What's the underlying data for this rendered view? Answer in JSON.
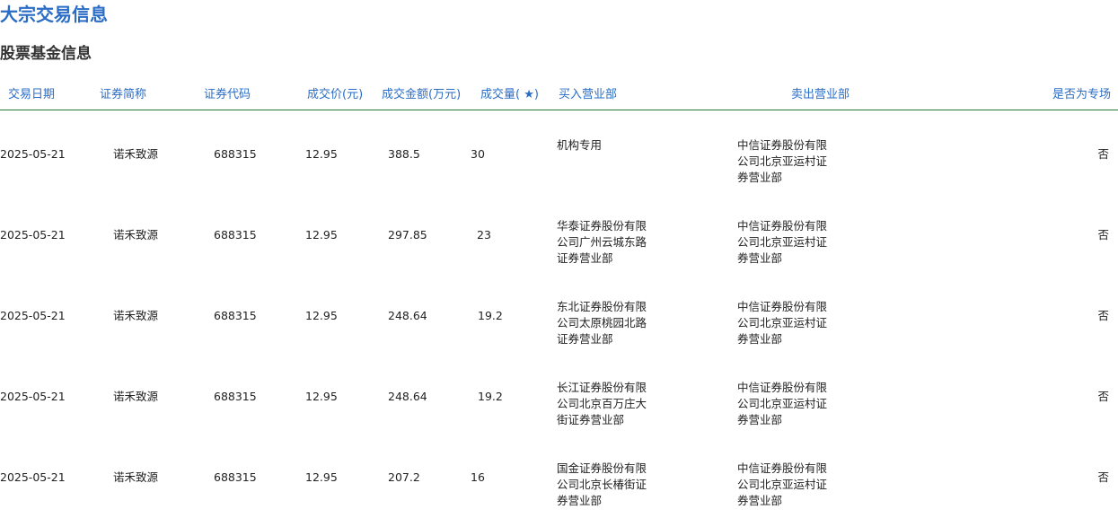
{
  "page": {
    "title": "大宗交易信息",
    "section_title": "股票基金信息"
  },
  "table": {
    "headers": {
      "date": "交易日期",
      "name": "证券简称",
      "code": "证券代码",
      "price": "成交价(元)",
      "amount": "成交金额(万元)",
      "volume": "成交量( ★)",
      "buyer": "买入营业部",
      "seller": "卖出营业部",
      "special": "是否为专场"
    },
    "rows": [
      {
        "date": "2025-05-21",
        "name": "诺禾致源",
        "code": "688315",
        "price": "12.95",
        "amount": "388.5",
        "volume": "30",
        "buyer": "机构专用",
        "seller": "中信证券股份有限公司北京亚运村证券营业部",
        "special": "否"
      },
      {
        "date": "2025-05-21",
        "name": "诺禾致源",
        "code": "688315",
        "price": "12.95",
        "amount": "297.85",
        "volume": "23",
        "buyer": "华泰证券股份有限公司广州云城东路证券营业部",
        "seller": "中信证券股份有限公司北京亚运村证券营业部",
        "special": "否"
      },
      {
        "date": "2025-05-21",
        "name": "诺禾致源",
        "code": "688315",
        "price": "12.95",
        "amount": "248.64",
        "volume": "19.2",
        "buyer": "东北证券股份有限公司太原桃园北路证券营业部",
        "seller": "中信证券股份有限公司北京亚运村证券营业部",
        "special": "否"
      },
      {
        "date": "2025-05-21",
        "name": "诺禾致源",
        "code": "688315",
        "price": "12.95",
        "amount": "248.64",
        "volume": "19.2",
        "buyer": "长江证券股份有限公司北京百万庄大街证券营业部",
        "seller": "中信证券股份有限公司北京亚运村证券营业部",
        "special": "否"
      },
      {
        "date": "2025-05-21",
        "name": "诺禾致源",
        "code": "688315",
        "price": "12.95",
        "amount": "207.2",
        "volume": "16",
        "buyer": "国金证券股份有限公司北京长椿街证券营业部",
        "seller": "中信证券股份有限公司北京亚运村证券营业部",
        "special": "否"
      }
    ]
  }
}
